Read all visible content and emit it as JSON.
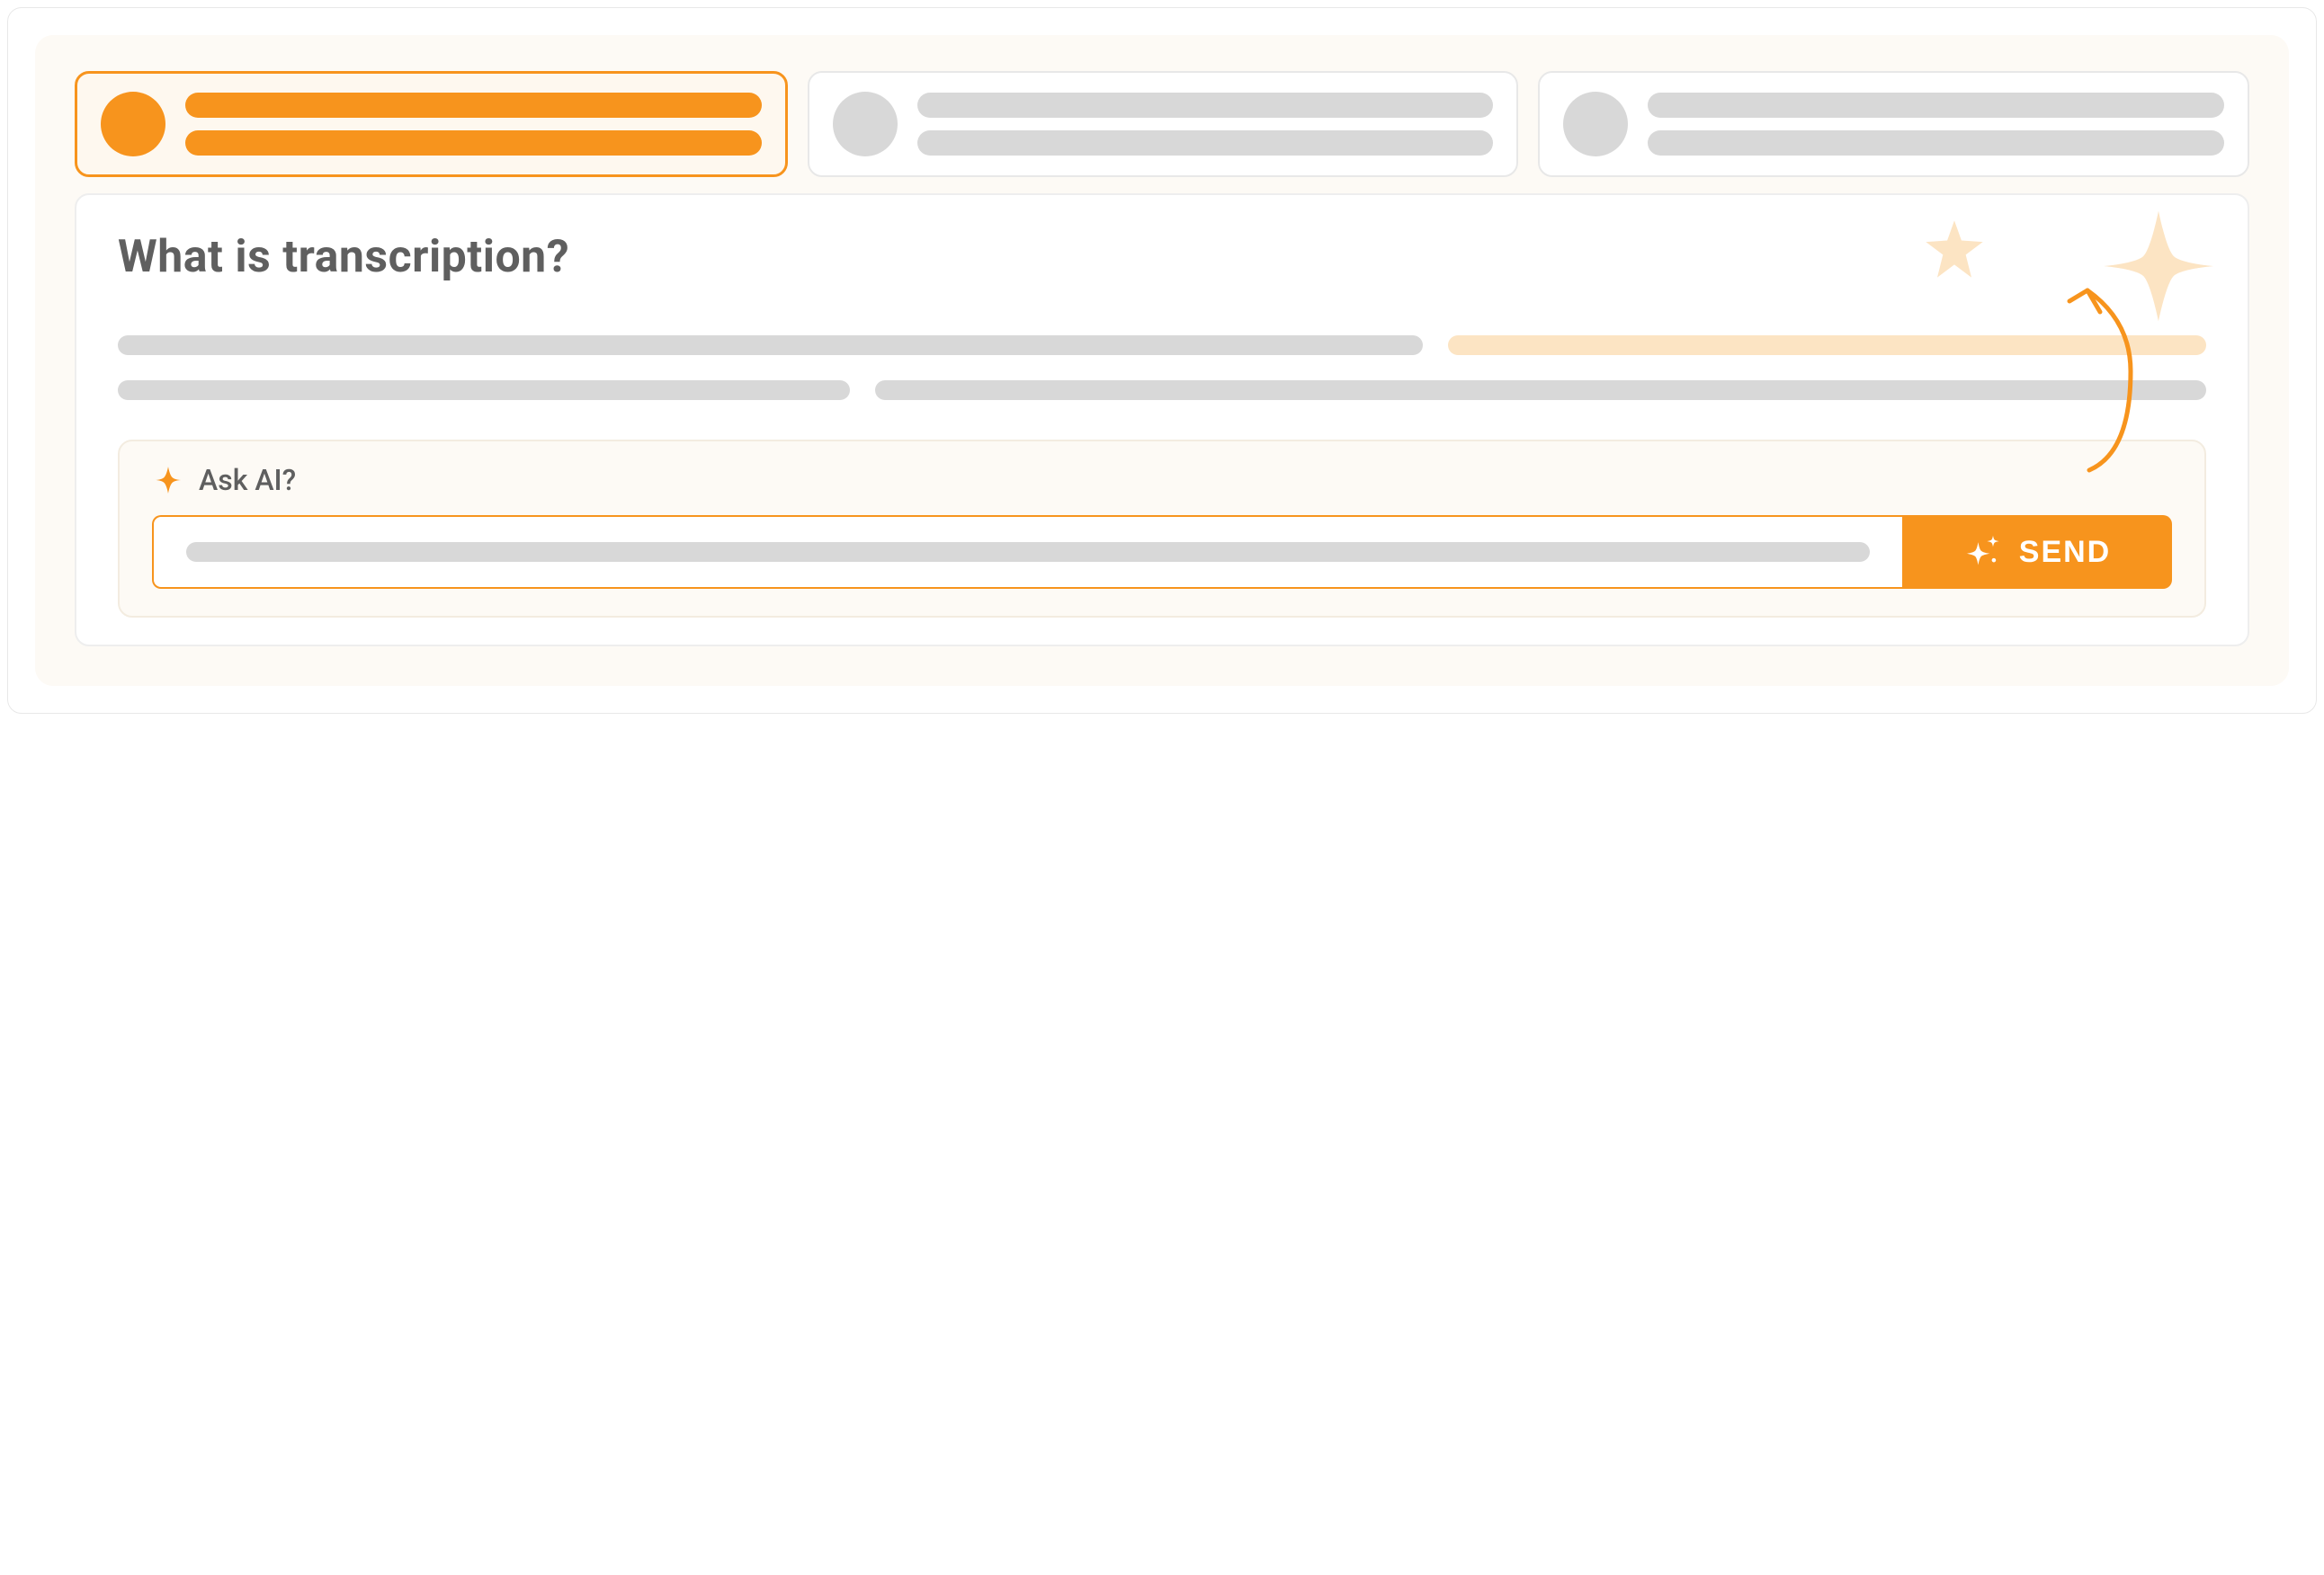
{
  "tabs": [
    {
      "active": true
    },
    {
      "active": false
    },
    {
      "active": false
    }
  ],
  "content": {
    "title": "What is transcription?"
  },
  "ask_ai": {
    "label": "Ask AI?",
    "send_label": "SEND"
  },
  "colors": {
    "accent": "#f7941d",
    "accent_light": "#fce4c3",
    "placeholder": "#d8d8d8",
    "text": "#5f5f5f",
    "panel_bg": "#fdfaf5"
  },
  "icons": {
    "sparkle": "sparkle-icon",
    "star_small": "star-small-icon",
    "star_large": "star-large-icon",
    "sparkles_send": "sparkles-icon"
  }
}
